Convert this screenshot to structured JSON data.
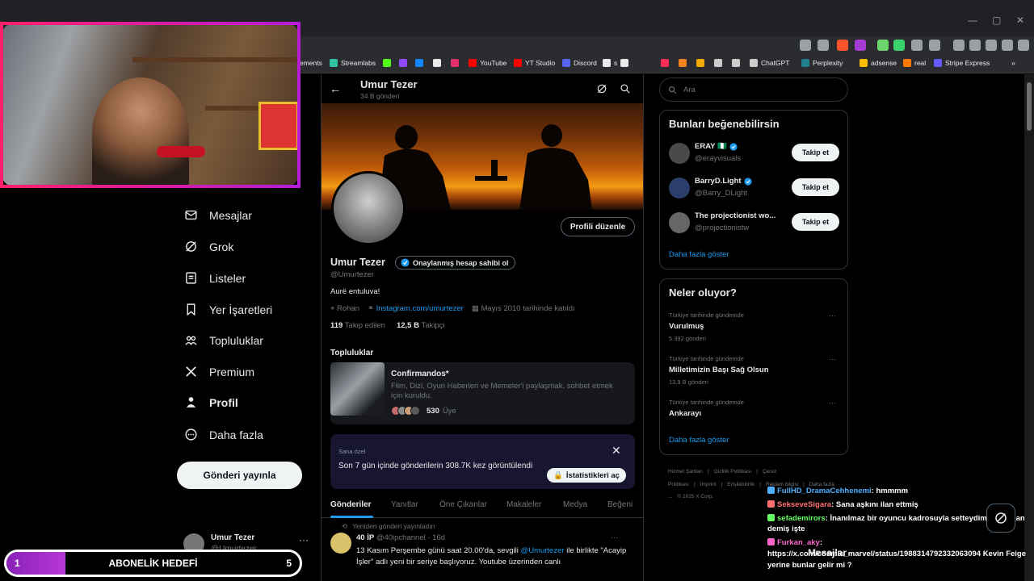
{
  "browser": {
    "win_controls": [
      "—",
      "▢",
      "✕"
    ],
    "bookmarks": [
      {
        "label": "ements",
        "color": "#555555"
      },
      {
        "label": "Streamlabs",
        "color": "#31c3a2"
      },
      {
        "label": "",
        "color": "#53fc18"
      },
      {
        "label": "",
        "color": "#9146ff"
      },
      {
        "label": "",
        "color": "#1185fe"
      },
      {
        "label": "",
        "color": "#e7e9ea"
      },
      {
        "label": "",
        "color": "#e1306c"
      },
      {
        "label": "YouTube",
        "color": "#ff0000"
      },
      {
        "label": "YT Studio",
        "color": "#ff0000"
      },
      {
        "label": "Discord",
        "color": "#5865f2"
      },
      {
        "label": "s",
        "color": "#e7e9ea"
      },
      {
        "label": "",
        "color": "#e7e9ea"
      },
      {
        "label": "",
        "color": "#ff2d55"
      },
      {
        "label": "",
        "color": "#f48120"
      },
      {
        "label": "",
        "color": "#f2a900"
      },
      {
        "label": "",
        "color": "#cccccc"
      },
      {
        "label": "",
        "color": "#cccccc"
      },
      {
        "label": "ChatGPT",
        "color": "#cccccc"
      },
      {
        "label": "Perplexity",
        "color": "#20808d"
      },
      {
        "label": "adsense",
        "color": "#fbbc04"
      },
      {
        "label": "real",
        "color": "#ff7a00"
      },
      {
        "label": "Stripe Express",
        "color": "#635bff"
      }
    ],
    "bookmarks_overflow": "»"
  },
  "nav": {
    "items": [
      {
        "label": "Mesajlar",
        "icon": "mail-icon"
      },
      {
        "label": "Grok",
        "icon": "grok-icon"
      },
      {
        "label": "Listeler",
        "icon": "list-icon"
      },
      {
        "label": "Yer İşaretleri",
        "icon": "bookmark-icon"
      },
      {
        "label": "Topluluklar",
        "icon": "communities-icon"
      },
      {
        "label": "Premium",
        "icon": "x-logo-icon"
      },
      {
        "label": "Profil",
        "icon": "profile-icon"
      },
      {
        "label": "Daha fazla",
        "icon": "more-circle-icon"
      }
    ],
    "post_button": "Gönderi yayınla",
    "account": {
      "name": "Umur Tezer",
      "handle": "@Umurtezer",
      "more": "···"
    }
  },
  "profile": {
    "back": "←",
    "header_name": "Umur Tezer",
    "post_count": "34 B gönderi",
    "edit_button": "Profili düzenle",
    "name": "Umur Tezer",
    "verify_pill": "Onaylanmış hesap sahibi ol",
    "handle": "@Umurtezer",
    "bio": "Aurë entuluva!",
    "location": "Rohan",
    "link": "Instagram.com/umurtezer",
    "joined": "Mayıs 2010 tarihinde katıldı",
    "following_count": "119",
    "following_label": "Takip edilen",
    "followers_count": "12,5 B",
    "followers_label": "Takipçi",
    "communities_title": "Topluluklar",
    "community": {
      "name": "Confirmandos*",
      "description": "Film, Dizi, Oyun Haberleri ve Memeler'i paylaşmak, sohbet etmek için kuruldu.",
      "members": "530",
      "members_label": "Üye"
    },
    "stats": {
      "label": "Sana özel",
      "text": "Son 7 gün içinde gönderilerin 308.7K kez görüntülendi",
      "button": "İstatistikleri aç",
      "close": "✕"
    },
    "tabs": [
      "Gönderiler",
      "Yanıtlar",
      "Öne Çıkanlar",
      "Makaleler",
      "Medya",
      "Beğeni"
    ],
    "active_tab": 0,
    "tweet": {
      "repost_label": "Yeniden gönderi yayınladın",
      "author": "40 İP",
      "handle": "@40ipchannel",
      "time": "16d",
      "text_1": "13 Kasım Perşembe günü saat 20.00'da, sevgili",
      "mention": "@Umurtezer",
      "text_2": "ile birlikte \"Acayip İşler\" adlı yeni bir seriye başlıyoruz. Youtube üzerinden canlı",
      "more": "···"
    }
  },
  "right": {
    "search_placeholder": "Ara",
    "wtf": {
      "title": "Bunları beğenebilirsin",
      "users": [
        {
          "name": "ERAY 🇳🇬",
          "handle": "@erayvisuals",
          "button": "Takip et",
          "verified": true,
          "color": "#4a4a4a"
        },
        {
          "name": "BarryD.Light",
          "handle": "@Barry_DLight",
          "button": "Takip et",
          "verified": true,
          "color": "#2c3e6b"
        },
        {
          "name": "The projectionist wo...",
          "handle": "@projectionistw",
          "button": "Takip et",
          "verified": false,
          "color": "#666666"
        }
      ],
      "show_more": "Daha fazla göster"
    },
    "trends": {
      "title": "Neler oluyor?",
      "items": [
        {
          "context": "Türkiye tarihinde gündemde",
          "topic": "Vurulmuş",
          "count": "5.392 gönderi"
        },
        {
          "context": "Türkiye tarihinde gündemde",
          "topic": "Milletimizin Başı Sağ Olsun",
          "count": "13,9 B gönderi"
        },
        {
          "context": "Türkiye tarihinde gündemde",
          "topic": "Ankarayı",
          "count": ""
        }
      ],
      "more": "···",
      "show_more": "Daha fazla göster"
    },
    "footer": [
      "Hizmet Şartları",
      "|",
      "Gizlilik Politikası",
      "|",
      "Çerez Politikası",
      "|",
      "Imprint",
      "|",
      "Erişilebilirlik",
      "|",
      "Reklam bilgisi",
      "|",
      "Daha fazla ...",
      "© 2025 X Corp."
    ]
  },
  "overlay": {
    "subgoal": {
      "start": "1",
      "label": "ABONELİK HEDEFİ",
      "end": "5",
      "progress": 0.2
    },
    "chat": [
      {
        "user": "FullHD_DramaCehhenemi",
        "text": ": hmmmm",
        "color": "#4fb0ff"
      },
      {
        "user": "SekseveSigara",
        "text": ": Sana aşkını ilan ettmiş",
        "color": "#ff7070"
      },
      {
        "user": "sefademirors",
        "text": ": İnanılmaz bir oyuncu kadrosuyla setteydim falan filan demiş işte",
        "color": "#63ff63"
      },
      {
        "user": "Furkan_aky",
        "text": ": https://x.com/cosmic_marvel/status/1988314792332063094 Kevin Feige yerine bunlar gelir mi ?",
        "color": "#ff66cc"
      }
    ],
    "messages_drawer": "Mesajlar"
  }
}
